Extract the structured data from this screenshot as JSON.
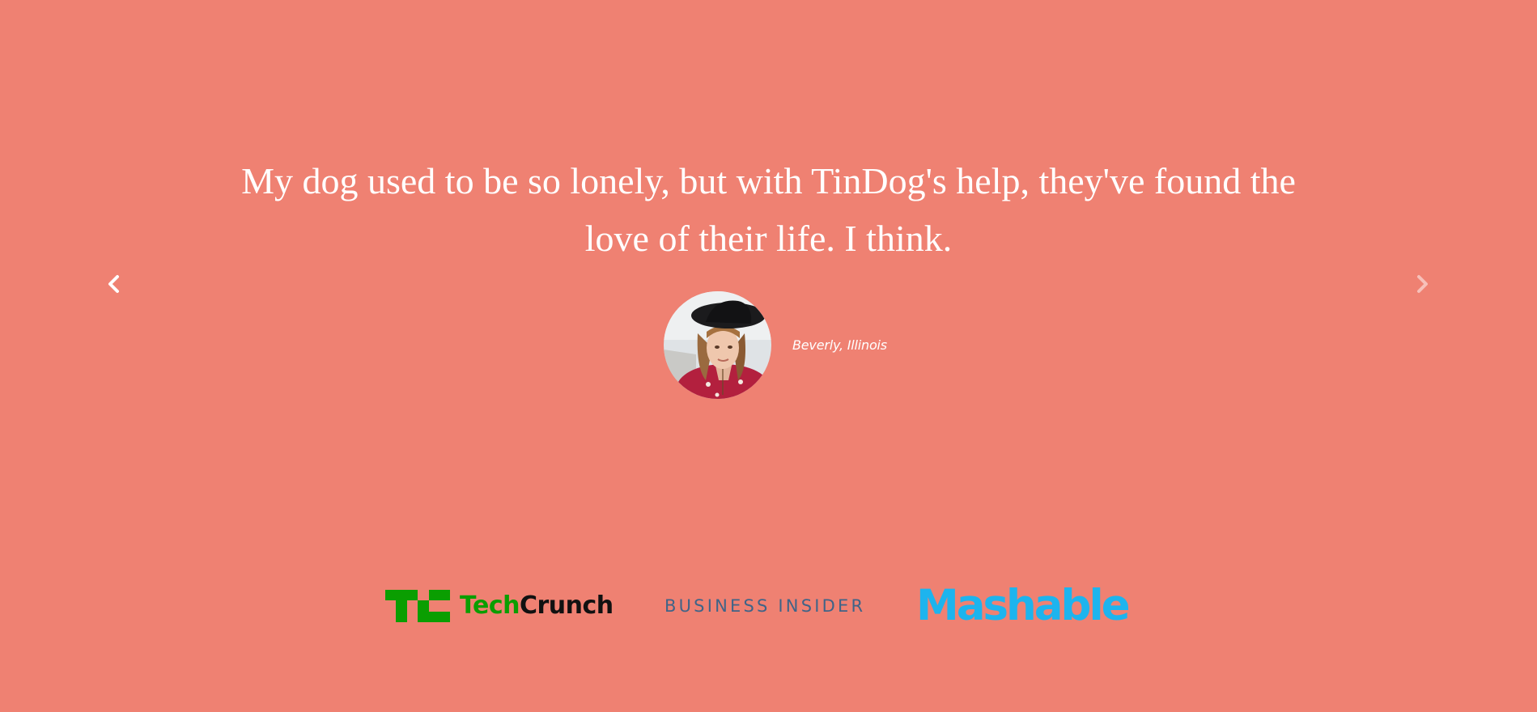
{
  "testimonial": {
    "quote": "My dog used to be so lonely, but with TinDog's help, they've found the love of their life. I think.",
    "author": "Beverly, Illinois",
    "avatar_icon": "woman-portrait-avatar"
  },
  "carousel": {
    "prev_icon": "chevron-left-icon",
    "next_icon": "chevron-right-icon"
  },
  "press": {
    "logos": [
      {
        "name": "TechCrunch",
        "part1": "Tech",
        "part2": "Crunch",
        "color1": "#0a9e01",
        "color2": "#111111"
      },
      {
        "name": "BUSINESS INSIDER",
        "color": "#3f6488"
      },
      {
        "name": "Mashable",
        "color": "#1db4ee"
      }
    ]
  },
  "colors": {
    "background": "#ef8172",
    "text": "#ffffff"
  }
}
